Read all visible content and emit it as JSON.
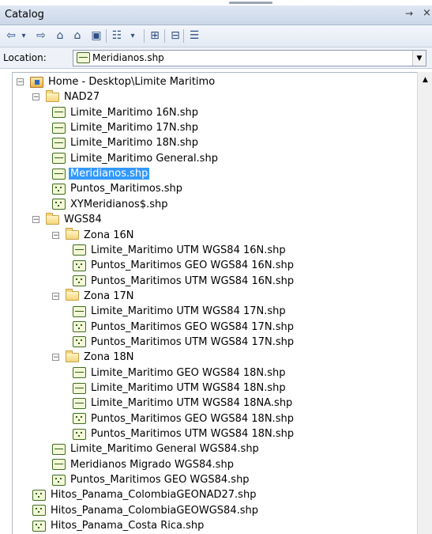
{
  "window": {
    "title": "Catalog",
    "pin_glyph": "→",
    "close_glyph": "×"
  },
  "toolbar": {
    "buttons": [
      {
        "name": "back-icon",
        "glyph": "⇦"
      },
      {
        "name": "back-dropdown-icon",
        "glyph": "▾"
      },
      {
        "name": "forward-icon",
        "glyph": "⇨"
      },
      {
        "name": "up-one-level-icon",
        "glyph": "⌂"
      },
      {
        "name": "home-folder-icon",
        "glyph": "⌂"
      },
      {
        "name": "toggle-contents-icon",
        "glyph": "▣"
      },
      {
        "name": "view-options-icon",
        "glyph": "☷"
      },
      {
        "name": "view-dropdown-icon",
        "glyph": "▾"
      },
      {
        "name": "connect-folder-icon",
        "glyph": "⊞"
      },
      {
        "name": "disconnect-folder-icon",
        "glyph": "⊟"
      },
      {
        "name": "options-icon",
        "glyph": "☰"
      }
    ]
  },
  "location": {
    "label": "Location:",
    "value": "Meridianos.shp",
    "icon": "line-shapefile-icon"
  },
  "tree": {
    "items": [
      {
        "label": "Home - Desktop\\Limite Maritimo",
        "type": "home",
        "exp": "−",
        "lvl": 0
      },
      {
        "label": "NAD27",
        "type": "folder",
        "exp": "−",
        "lvl": 1
      },
      {
        "label": "Limite_Maritimo 16N.shp",
        "type": "line",
        "lvl": 2
      },
      {
        "label": "Limite_Maritimo 17N.shp",
        "type": "line",
        "lvl": 2
      },
      {
        "label": "Limite_Maritimo 18N.shp",
        "type": "line",
        "lvl": 2
      },
      {
        "label": "Limite_Maritimo General.shp",
        "type": "line",
        "lvl": 2
      },
      {
        "label": "Meridianos.shp",
        "type": "line",
        "lvl": 2,
        "selected": true
      },
      {
        "label": "Puntos_Maritimos.shp",
        "type": "point",
        "lvl": 2
      },
      {
        "label": "XYMeridianos$.shp",
        "type": "point",
        "lvl": 2
      },
      {
        "label": "WGS84",
        "type": "folder",
        "exp": "−",
        "lvl": 1
      },
      {
        "label": "Zona 16N",
        "type": "folder",
        "exp": "−",
        "lvl": 2
      },
      {
        "label": "Limite_Maritimo UTM WGS84 16N.shp",
        "type": "line",
        "lvl": 3
      },
      {
        "label": "Puntos_Maritimos GEO WGS84 16N.shp",
        "type": "point",
        "lvl": 3
      },
      {
        "label": "Puntos_Maritimos UTM WGS84 16N.shp",
        "type": "point",
        "lvl": 3
      },
      {
        "label": "Zona 17N",
        "type": "folder",
        "exp": "−",
        "lvl": 2
      },
      {
        "label": "Limite_Maritimo UTM WGS84 17N.shp",
        "type": "line",
        "lvl": 3
      },
      {
        "label": "Puntos_Maritimos GEO WGS84 17N.shp",
        "type": "point",
        "lvl": 3
      },
      {
        "label": "Puntos_Maritimos UTM WGS84 17N.shp",
        "type": "point",
        "lvl": 3
      },
      {
        "label": "Zona 18N",
        "type": "folder",
        "exp": "−",
        "lvl": 2
      },
      {
        "label": "Limite_Maritimo GEO WGS84 18N.shp",
        "type": "line",
        "lvl": 3
      },
      {
        "label": "Limite_Maritimo UTM WGS84 18N.shp",
        "type": "line",
        "lvl": 3
      },
      {
        "label": "Limite_Maritimo UTM WGS84 18NA.shp",
        "type": "line",
        "lvl": 3
      },
      {
        "label": "Puntos_Maritimos GEO WGS84 18N.shp",
        "type": "point",
        "lvl": 3
      },
      {
        "label": "Puntos_Maritimos UTM WGS84 18N.shp",
        "type": "point",
        "lvl": 3
      },
      {
        "label": "Limite_Maritimo General WGS84.shp",
        "type": "line",
        "lvl": 2
      },
      {
        "label": "Meridianos Migrado WGS84.shp",
        "type": "line",
        "lvl": 2
      },
      {
        "label": "Puntos_Maritimos GEO WGS84.shp",
        "type": "point",
        "lvl": 2
      },
      {
        "label": "Hitos_Panama_ColombiaGEONAD27.shp",
        "type": "point",
        "lvl": 1
      },
      {
        "label": "Hitos_Panama_ColombiaGEOWGS84.shp",
        "type": "point",
        "lvl": 1
      },
      {
        "label": "Hitos_Panama_Costa Rica.shp",
        "type": "point",
        "lvl": 1
      }
    ]
  },
  "colors": {
    "selection": "#3399ff",
    "title_bar": "#cbd7e8"
  }
}
